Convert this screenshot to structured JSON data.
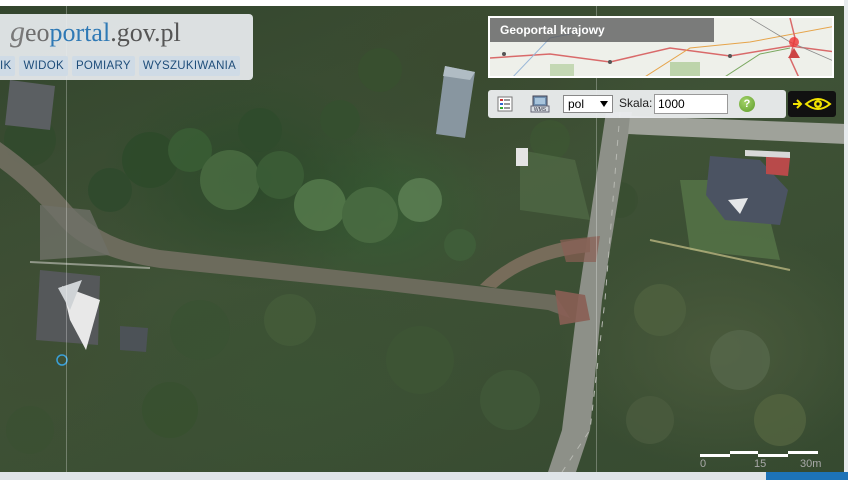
{
  "logo": {
    "g": "g",
    "eo": "eo",
    "portal": "portal",
    "domain": ".gov.pl"
  },
  "menu": {
    "items": [
      "IK",
      "WIDOK",
      "POMIARY",
      "WYSZUKIWANIA"
    ]
  },
  "overview": {
    "title": "Geoportal krajowy"
  },
  "toolbar": {
    "language_value": "pol",
    "scale_label": "Skala:",
    "scale_value": "1000",
    "help_symbol": "?",
    "icons": [
      "legend-icon",
      "wms-icon",
      "help-icon",
      "arrow-icon",
      "eye-icon"
    ]
  },
  "scalebar": {
    "labels": [
      "0",
      "15",
      "30m"
    ]
  },
  "colors": {
    "menu_text": "#1e4d7a",
    "menu_bg": "#cfdbe6",
    "logo_blue": "#2f79b5",
    "eye_yellow": "#f2e400",
    "help_green": "#5c9b2a",
    "bottom_blue": "#1d73b8"
  }
}
